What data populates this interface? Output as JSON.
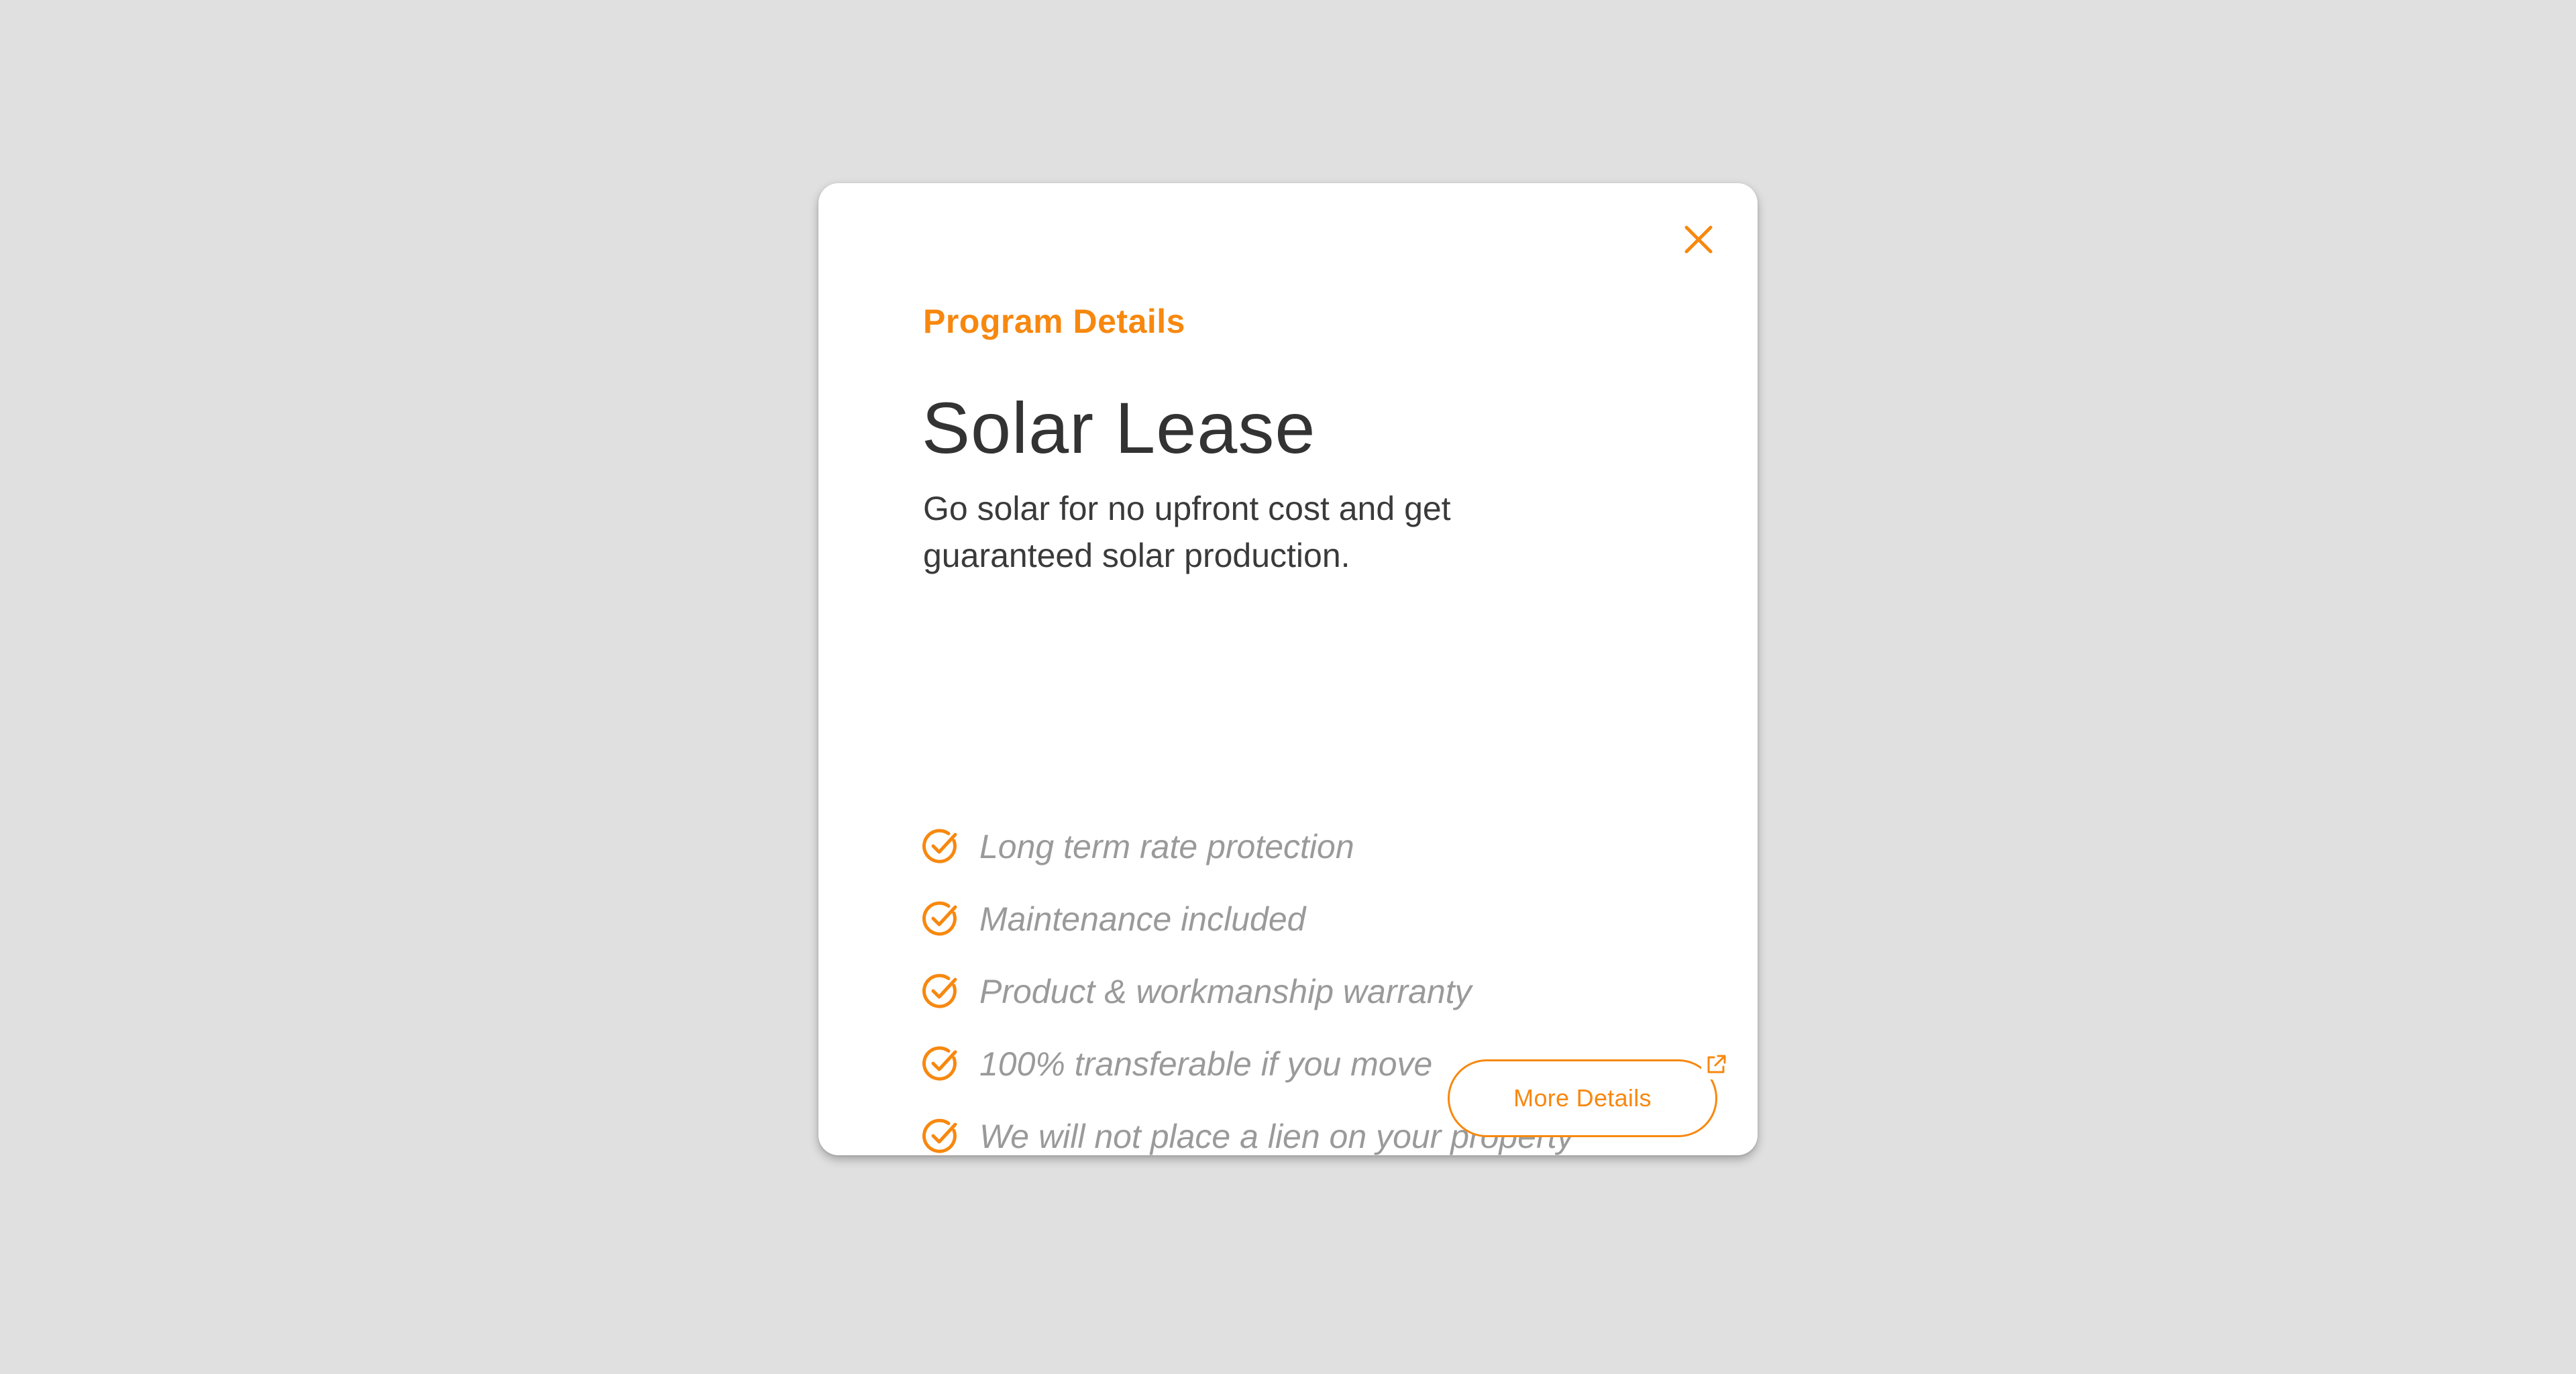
{
  "colors": {
    "accent": "#f7880f",
    "background": "#e0e0e0",
    "card": "#ffffff",
    "title_text": "#333333",
    "feature_text": "#9a9a9a"
  },
  "modal": {
    "eyebrow": "Program Details",
    "title": "Solar Lease",
    "description": "Go solar for no upfront cost and get guaranteed solar production.",
    "close_icon": "close-icon",
    "features": [
      {
        "icon": "check-circle-icon",
        "label": "Long term rate protection"
      },
      {
        "icon": "check-circle-icon",
        "label": "Maintenance included"
      },
      {
        "icon": "check-circle-icon",
        "label": "Product & workmanship warranty"
      },
      {
        "icon": "check-circle-icon",
        "label": "100% transferable if you move"
      },
      {
        "icon": "check-circle-icon",
        "label": "We will not place a lien on your property"
      }
    ],
    "more_button": {
      "label": "More Details",
      "icon": "external-link-icon"
    }
  }
}
